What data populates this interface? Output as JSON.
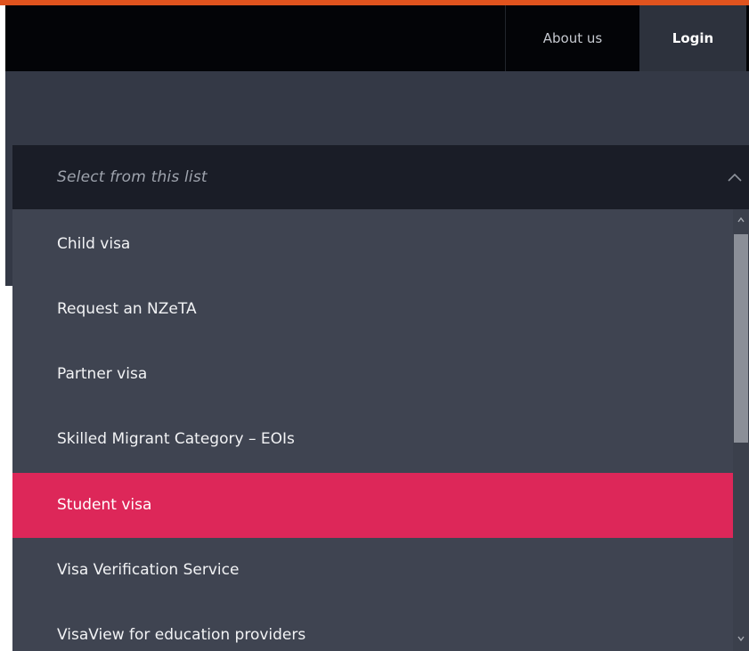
{
  "header": {
    "nav": {
      "about": "About us",
      "login": "Login"
    }
  },
  "select": {
    "placeholder": "Select from this list",
    "expanded": true,
    "options": [
      {
        "label": "Child visa"
      },
      {
        "label": "Request an NZeTA"
      },
      {
        "label": "Partner visa"
      },
      {
        "label": "Skilled Migrant Category – EOIs"
      },
      {
        "label": "Student visa",
        "highlighted": true
      },
      {
        "label": "Visa Verification Service"
      },
      {
        "label": "VisaView for education providers"
      }
    ]
  },
  "icons": {
    "select_toggle": "chevron-up-icon",
    "scroll_up": "scroll-up-arrow-icon",
    "scroll_down": "scroll-down-arrow-icon"
  },
  "colors": {
    "accent_top": "#e0531e",
    "topbar": "#030407",
    "login_bg": "#2d323d",
    "hero": "#343946",
    "select_bg": "#1a1d27",
    "dropdown_bg": "#3f4451",
    "highlight": "#dd2759"
  }
}
